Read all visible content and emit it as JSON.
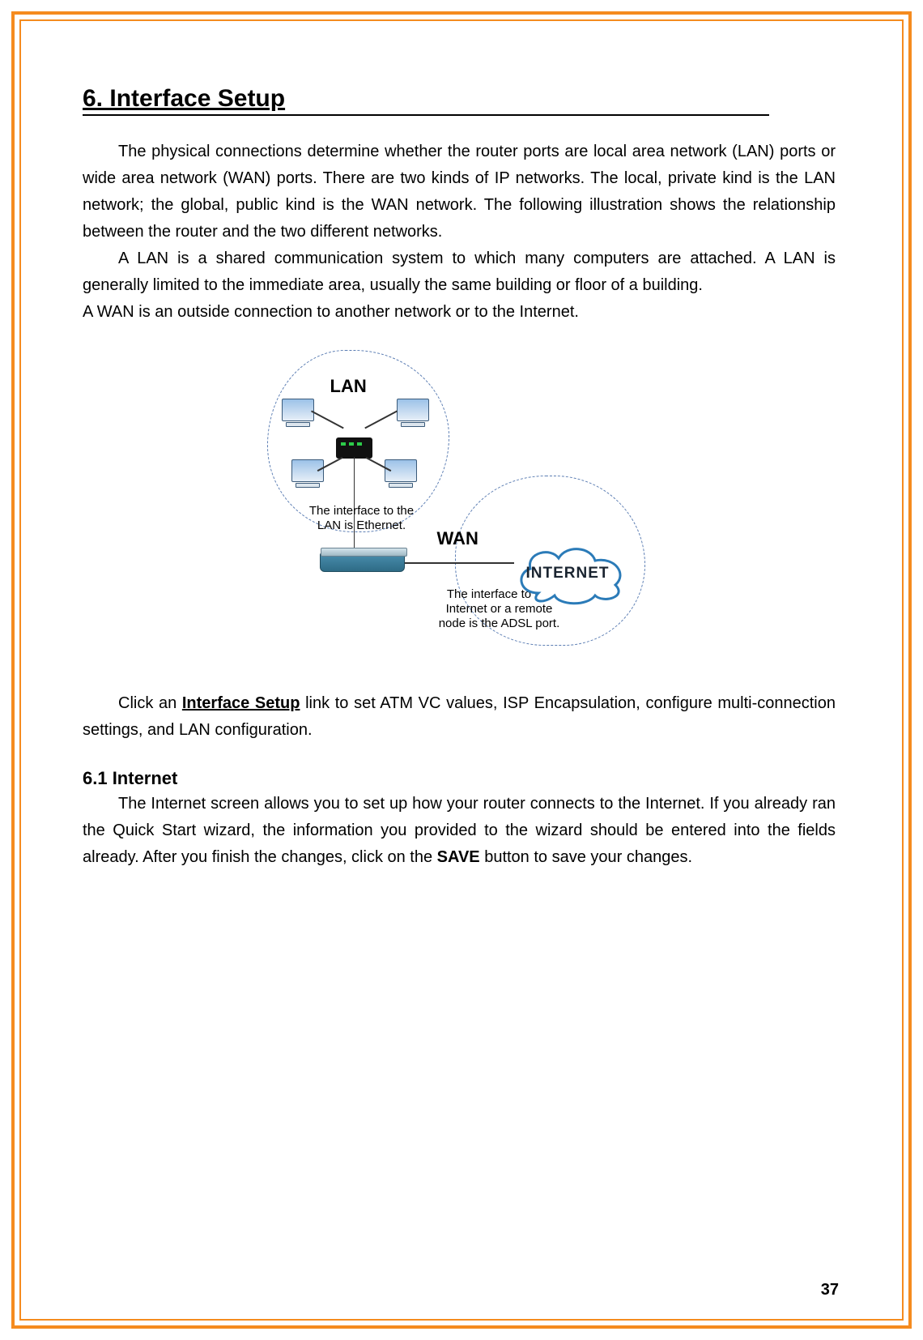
{
  "page_number": "37",
  "heading": "6. Interface Setup",
  "para1": "The physical connections determine whether the router ports are local area network (LAN) ports or wide area network (WAN) ports. There are two kinds of IP networks. The local, private kind is the LAN network; the global, public kind is the WAN network. The following illustration shows the relationship between the router and the two different networks.",
  "para2": "A LAN is a shared communication system to which many computers are attached. A LAN is generally limited to the immediate area, usually the same building or floor of a building.",
  "para3": "A WAN is an outside connection to another network or to the Internet.",
  "diagram": {
    "lan_label": "LAN",
    "wan_label": "WAN",
    "internet_label": "INTERNET",
    "lan_caption": "The interface to the LAN is Ethernet.",
    "wan_caption": "The interface to the Internet or a remote node is the ADSL port."
  },
  "para4_pre": "Click an ",
  "para4_link": "Interface Setup",
  "para4_post": " link to set ATM VC values, ISP Encapsulation, configure multi-connection settings, and LAN configuration.",
  "subheading": "6.1 Internet",
  "para5_pre": "The Internet screen allows you to set up how your router connects to the Internet. If you already ran the Quick Start wizard, the information you provided to the wizard should be entered into the fields already. After you finish the changes, click on the ",
  "para5_bold": "SAVE",
  "para5_post": " button to save your changes."
}
